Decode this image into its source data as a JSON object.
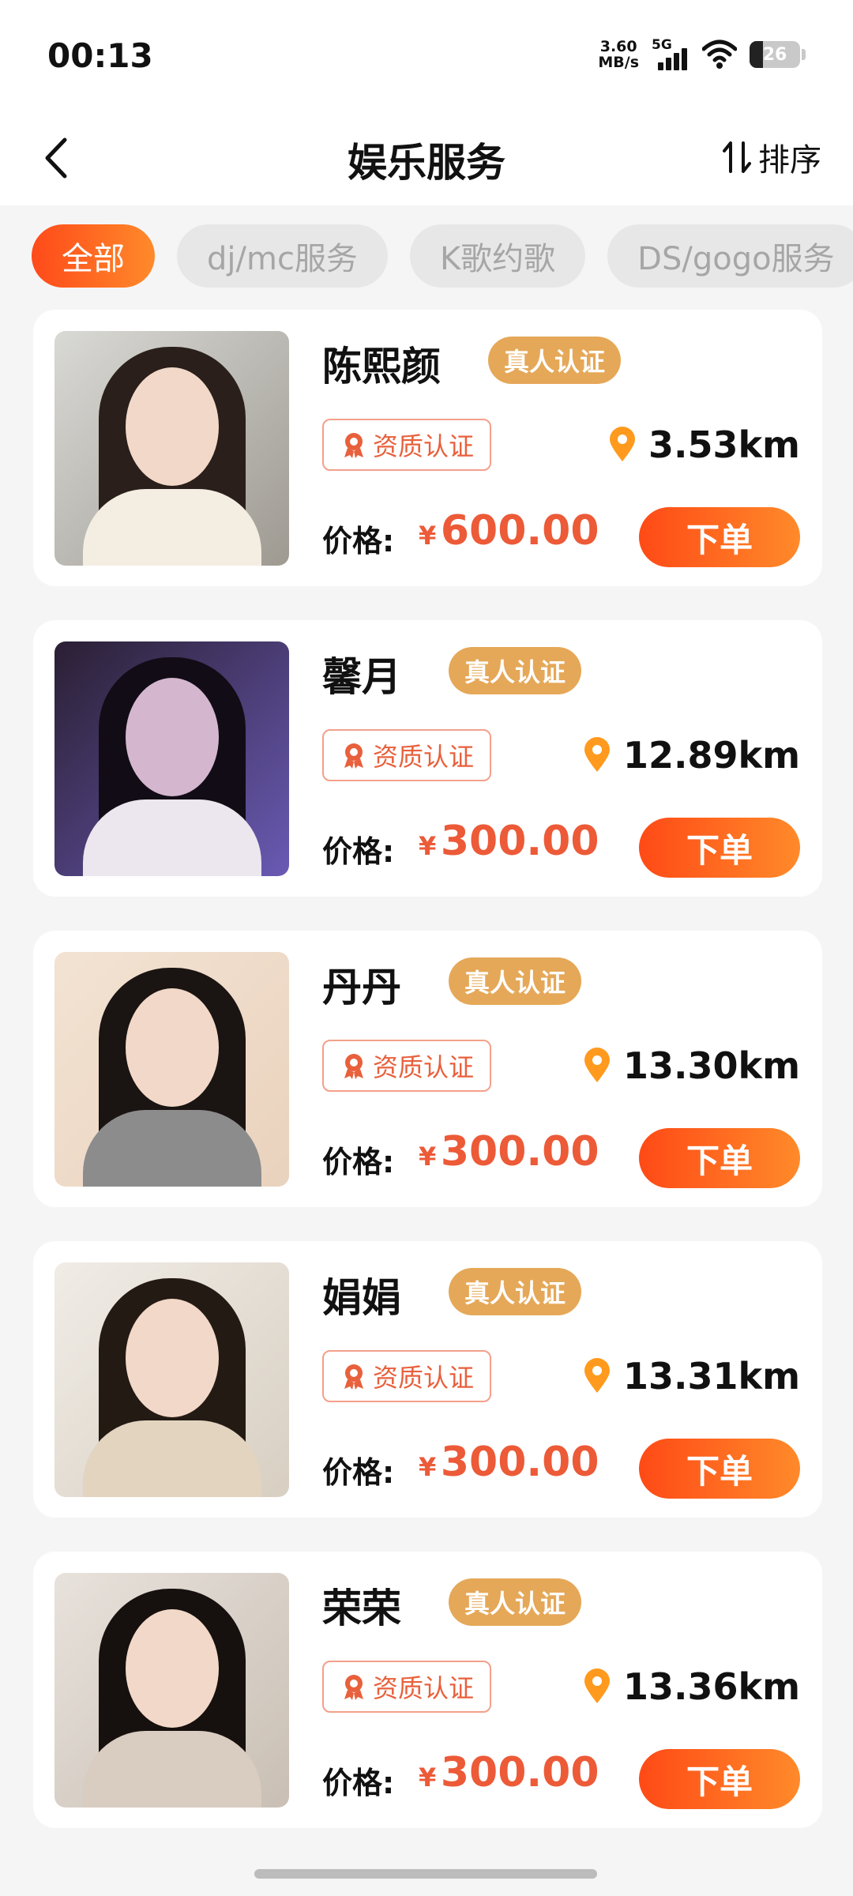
{
  "status_bar": {
    "time": "00:13",
    "net_speed_value": "3.60",
    "net_speed_unit": "MB/s",
    "network_type": "5G",
    "battery_level": "26"
  },
  "header": {
    "title": "娱乐服务",
    "sort_label": "排序"
  },
  "tabs": [
    {
      "label": "全部",
      "active": true
    },
    {
      "label": "dj/mc服务",
      "active": false
    },
    {
      "label": "K歌约歌",
      "active": false
    },
    {
      "label": "DS/gogo服务",
      "active": false
    }
  ],
  "providers": [
    {
      "name": "陈熙颜",
      "real_badge": "真人认证",
      "qual_badge": "资质认证",
      "distance": "3.53km",
      "price_label": "价格:",
      "currency": "¥",
      "price": "600.00",
      "order_label": "下单"
    },
    {
      "name": "馨月",
      "real_badge": "真人认证",
      "qual_badge": "资质认证",
      "distance": "12.89km",
      "price_label": "价格:",
      "currency": "¥",
      "price": "300.00",
      "order_label": "下单"
    },
    {
      "name": "丹丹",
      "real_badge": "真人认证",
      "qual_badge": "资质认证",
      "distance": "13.30km",
      "price_label": "价格:",
      "currency": "¥",
      "price": "300.00",
      "order_label": "下单"
    },
    {
      "name": "娟娟",
      "real_badge": "真人认证",
      "qual_badge": "资质认证",
      "distance": "13.31km",
      "price_label": "价格:",
      "currency": "¥",
      "price": "300.00",
      "order_label": "下单"
    },
    {
      "name": "荣荣",
      "real_badge": "真人认证",
      "qual_badge": "资质认证",
      "distance": "13.36km",
      "price_label": "价格:",
      "currency": "¥",
      "price": "300.00",
      "order_label": "下单"
    }
  ],
  "colors": {
    "accent": "#ff5a1f",
    "price": "#ec5a38",
    "real_badge": "#e5a858",
    "location_pin": "#ff9a1e"
  }
}
